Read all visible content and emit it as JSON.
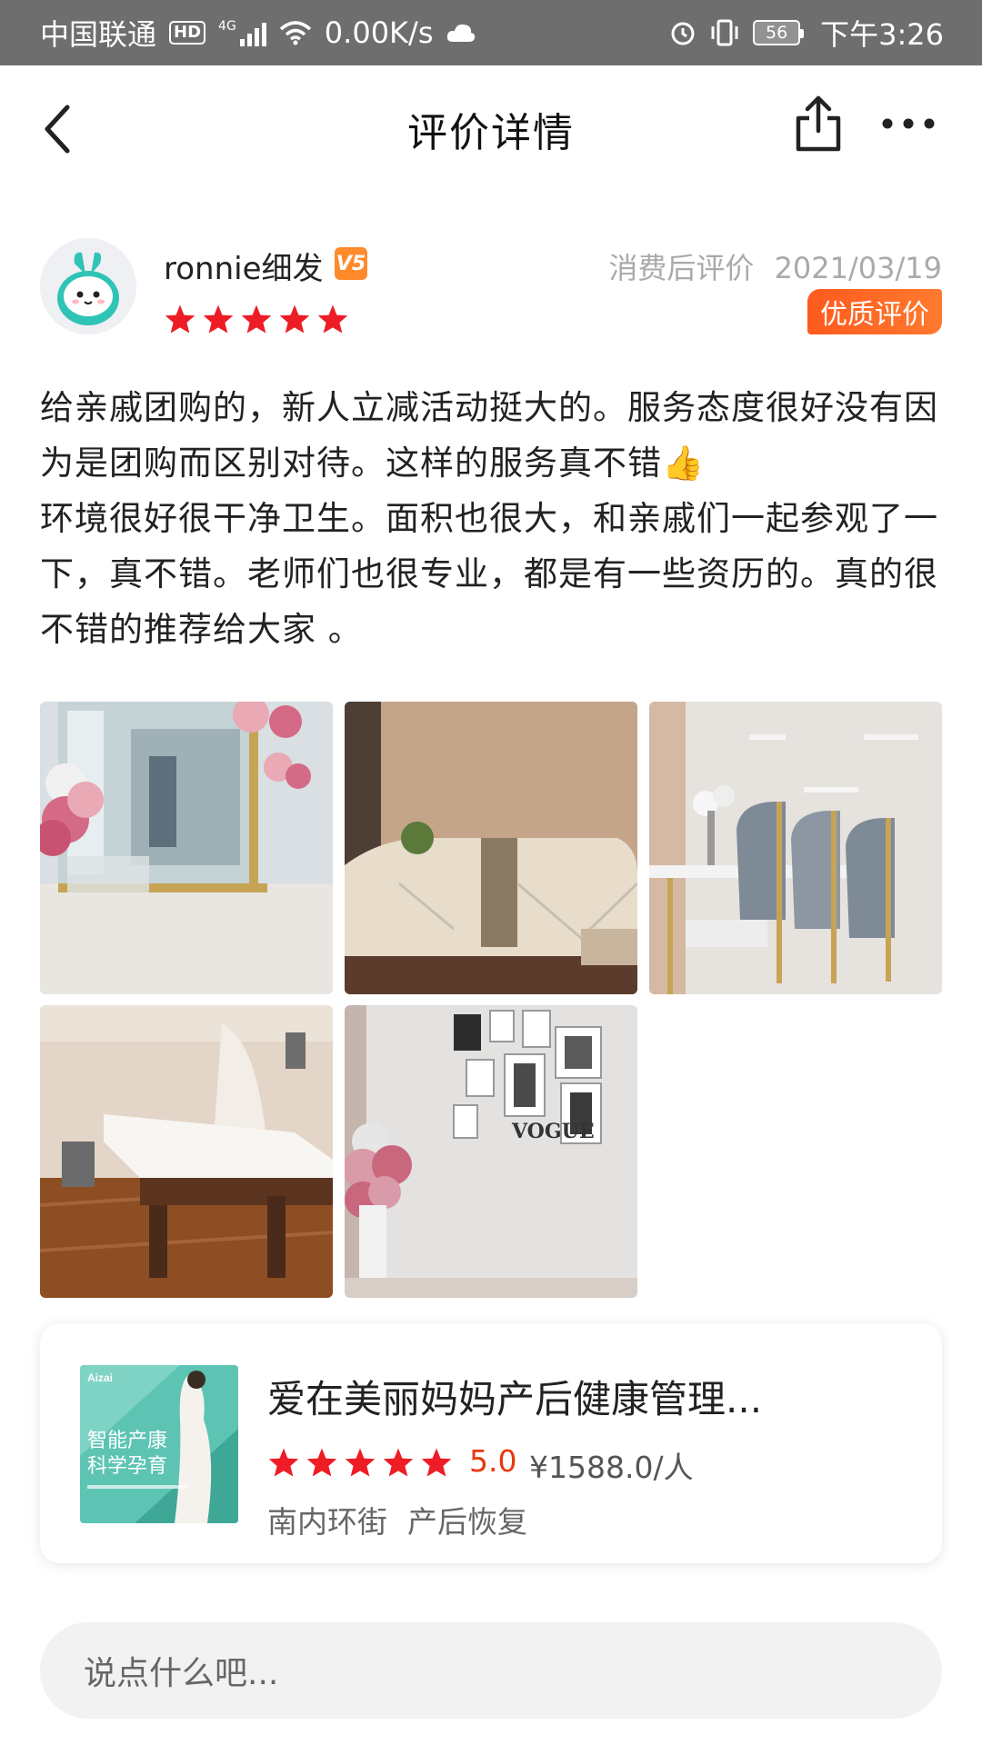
{
  "status_bar": {
    "carrier": "中国联通",
    "hd": "HD",
    "network": "4G",
    "speed": "0.00K/s",
    "battery": "56",
    "time": "下午3:26"
  },
  "nav": {
    "title": "评价详情",
    "icons": [
      "back-arrow-icon",
      "share-icon",
      "more-icon"
    ]
  },
  "review": {
    "user_name": "ronnie细发",
    "level_badge": "V5",
    "rating_stars": 5,
    "meta": "消费后评价",
    "date": "2021/03/19",
    "quality_badge": "优质评价",
    "paragraphs": [
      "给亲戚团购的，新人立减活动挺大的。服务态度很好没有因为是团购而区别对待。这样的服务真不错👍",
      "环境很好很干净卫生。面积也很大，和亲戚们一起参观了一下，真不错。老师们也很专业，都是有一些资历的。真的很不错的推荐给大家 。"
    ],
    "photos": [
      "glass-door-balloons-photo",
      "sofa-photo",
      "dining-chairs-photo",
      "massage-bed-photo",
      "photo-wall-vogue-photo"
    ]
  },
  "shop": {
    "name": "爱在美丽妈妈产后健康管理...",
    "thumb_text": [
      "Aizai",
      "智能产康",
      "科学孕育"
    ],
    "rating_stars": 5,
    "score": "5.0",
    "price": "¥1588.0/人",
    "tags": [
      "南内环街",
      "产后恢复"
    ]
  },
  "comment": {
    "placeholder": "说点什么吧..."
  },
  "colors": {
    "star": "#ee1c25",
    "accent": "#ff5a1e",
    "score": "#e8380d"
  }
}
